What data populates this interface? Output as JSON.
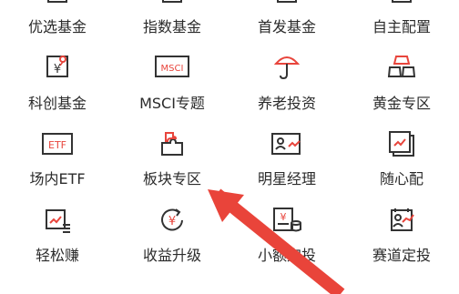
{
  "grid": {
    "items": [
      {
        "label": "优选基金",
        "icon": "fund-icon"
      },
      {
        "label": "指数基金",
        "icon": "index-icon"
      },
      {
        "label": "首发基金",
        "icon": "new-fund-icon"
      },
      {
        "label": "自主配置",
        "icon": "config-icon"
      },
      {
        "label": "科创基金",
        "icon": "tech-fund-icon"
      },
      {
        "label": "MSCI专题",
        "icon": "msci-icon"
      },
      {
        "label": "养老投资",
        "icon": "umbrella-icon"
      },
      {
        "label": "黄金专区",
        "icon": "gold-bars-icon"
      },
      {
        "label": "场内ETF",
        "icon": "etf-icon"
      },
      {
        "label": "板块专区",
        "icon": "puzzle-icon"
      },
      {
        "label": "明星经理",
        "icon": "manager-card-icon"
      },
      {
        "label": "随心配",
        "icon": "chart-card-icon"
      },
      {
        "label": "轻松赚",
        "icon": "easy-earn-icon"
      },
      {
        "label": "收益升级",
        "icon": "yield-upgrade-icon"
      },
      {
        "label": "小额定投",
        "icon": "small-invest-icon"
      },
      {
        "label": "赛道定投",
        "icon": "track-invest-icon"
      }
    ],
    "icon_labels": {
      "msci": "MSCI",
      "etf": "ETF",
      "yen": "¥"
    }
  },
  "colors": {
    "icon_stroke": "#333333",
    "accent": "#e8453c",
    "arrow": "#e9443a",
    "text": "#2b2b2b"
  }
}
